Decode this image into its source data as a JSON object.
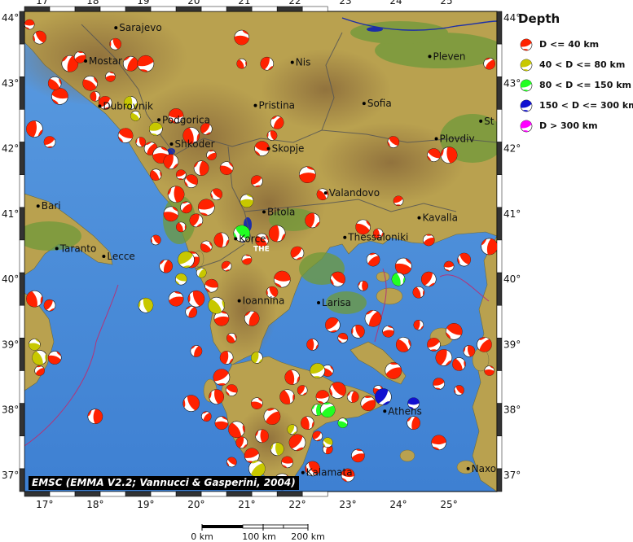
{
  "lon_ticks": [
    "17°",
    "18°",
    "19°",
    "20°",
    "21°",
    "22°",
    "23°",
    "24°",
    "25°"
  ],
  "lat_ticks": [
    "44°",
    "43°",
    "42°",
    "41°",
    "40°",
    "39°",
    "38°",
    "37°"
  ],
  "cities": [
    {
      "name": "Sarajevo",
      "lon": 18.41,
      "lat": 43.85
    },
    {
      "name": "Mostar",
      "lon": 17.81,
      "lat": 43.34
    },
    {
      "name": "Nis",
      "lon": 21.9,
      "lat": 43.32
    },
    {
      "name": "Pleven",
      "lon": 24.62,
      "lat": 43.41
    },
    {
      "name": "Pristina",
      "lon": 21.17,
      "lat": 42.66
    },
    {
      "name": "Sofia",
      "lon": 23.32,
      "lat": 42.69
    },
    {
      "name": "Dubrovnik",
      "lon": 18.09,
      "lat": 42.65
    },
    {
      "name": "Podgorica",
      "lon": 19.26,
      "lat": 42.44
    },
    {
      "name": "St",
      "lon": 25.63,
      "lat": 42.42
    },
    {
      "name": "Shkoder",
      "lon": 19.51,
      "lat": 42.07
    },
    {
      "name": "Skopje",
      "lon": 21.43,
      "lat": 42.0
    },
    {
      "name": "Plovdiv",
      "lon": 24.75,
      "lat": 42.15
    },
    {
      "name": "Bari",
      "lon": 16.87,
      "lat": 41.12
    },
    {
      "name": "Valandovo",
      "lon": 22.56,
      "lat": 41.32
    },
    {
      "name": "Bitola",
      "lon": 21.34,
      "lat": 41.03
    },
    {
      "name": "Kavalla",
      "lon": 24.41,
      "lat": 40.94
    },
    {
      "name": "Taranto",
      "lon": 17.24,
      "lat": 40.47
    },
    {
      "name": "Lecce",
      "lon": 18.17,
      "lat": 40.35
    },
    {
      "name": "Korce",
      "lon": 20.78,
      "lat": 40.62
    },
    {
      "name": "Thessaloniki",
      "lon": 22.94,
      "lat": 40.64
    },
    {
      "name": "Ioannina",
      "lon": 20.85,
      "lat": 39.67
    },
    {
      "name": "Larisa",
      "lon": 22.42,
      "lat": 39.64
    },
    {
      "name": "Athens",
      "lon": 23.73,
      "lat": 37.98
    },
    {
      "name": "Kalamata",
      "lon": 22.11,
      "lat": 37.04
    },
    {
      "name": "Naxo",
      "lon": 25.38,
      "lat": 37.1
    }
  ],
  "map_labels": [
    {
      "text": "THE",
      "lon": 21.13,
      "lat": 40.43
    }
  ],
  "legend": {
    "title": "Depth",
    "items": [
      {
        "label": "D <= 40 km",
        "color": "#ff2200"
      },
      {
        "label": "40 < D <= 80 km",
        "color": "#c8c800"
      },
      {
        "label": "80 < D <= 150 km",
        "color": "#22ff22"
      },
      {
        "label": "150 < D <= 300 km",
        "color": "#1010d0"
      },
      {
        "label": "D > 300 km",
        "color": "#ff00ff"
      }
    ]
  },
  "credit": "EMSC (EMMA V2.2; Vannucci & Gasperini, 2004)",
  "scale": {
    "labels": [
      "0 km",
      "100 km",
      "200 km"
    ]
  },
  "colors": {
    "sea": "#3f7fd0",
    "land_low": "#6f9a3a",
    "land_mid": "#bfa552",
    "land_high": "#7a5a2c",
    "border": "#555555",
    "lakes": "#1c2fa8"
  },
  "events": [
    {
      "lon": 16.7,
      "lat": 43.9,
      "c": 0
    },
    {
      "lon": 16.9,
      "lat": 43.7,
      "c": 0
    },
    {
      "lon": 17.5,
      "lat": 43.3,
      "c": 0
    },
    {
      "lon": 17.7,
      "lat": 43.4,
      "c": 0
    },
    {
      "lon": 17.9,
      "lat": 43.0,
      "c": 0
    },
    {
      "lon": 18.0,
      "lat": 42.8,
      "c": 0
    },
    {
      "lon": 18.2,
      "lat": 42.7,
      "c": 0
    },
    {
      "lon": 17.3,
      "lat": 42.8,
      "c": 0
    },
    {
      "lon": 18.4,
      "lat": 43.6,
      "c": 0
    },
    {
      "lon": 18.7,
      "lat": 43.3,
      "c": 0
    },
    {
      "lon": 18.3,
      "lat": 43.1,
      "c": 0
    },
    {
      "lon": 17.2,
      "lat": 43.0,
      "c": 0
    },
    {
      "lon": 16.8,
      "lat": 42.3,
      "c": 0
    },
    {
      "lon": 17.1,
      "lat": 42.1,
      "c": 0
    },
    {
      "lon": 18.6,
      "lat": 42.2,
      "c": 0
    },
    {
      "lon": 18.9,
      "lat": 42.1,
      "c": 0
    },
    {
      "lon": 19.1,
      "lat": 42.0,
      "c": 0
    },
    {
      "lon": 19.3,
      "lat": 41.9,
      "c": 0
    },
    {
      "lon": 19.2,
      "lat": 41.6,
      "c": 0
    },
    {
      "lon": 19.5,
      "lat": 41.8,
      "c": 0
    },
    {
      "lon": 19.7,
      "lat": 41.6,
      "c": 0
    },
    {
      "lon": 19.9,
      "lat": 41.5,
      "c": 0
    },
    {
      "lon": 19.6,
      "lat": 41.3,
      "c": 0
    },
    {
      "lon": 19.8,
      "lat": 41.1,
      "c": 0
    },
    {
      "lon": 19.5,
      "lat": 41.0,
      "c": 0
    },
    {
      "lon": 19.7,
      "lat": 40.8,
      "c": 0
    },
    {
      "lon": 20.0,
      "lat": 40.9,
      "c": 0
    },
    {
      "lon": 20.2,
      "lat": 41.1,
      "c": 0
    },
    {
      "lon": 20.4,
      "lat": 41.3,
      "c": 0
    },
    {
      "lon": 20.1,
      "lat": 41.7,
      "c": 0
    },
    {
      "lon": 20.3,
      "lat": 41.9,
      "c": 0
    },
    {
      "lon": 20.6,
      "lat": 41.7,
      "c": 0
    },
    {
      "lon": 19.9,
      "lat": 42.2,
      "c": 0
    },
    {
      "lon": 20.2,
      "lat": 42.3,
      "c": 0
    },
    {
      "lon": 19.6,
      "lat": 42.5,
      "c": 0
    },
    {
      "lon": 19.2,
      "lat": 40.6,
      "c": 0
    },
    {
      "lon": 19.4,
      "lat": 40.2,
      "c": 0
    },
    {
      "lon": 19.9,
      "lat": 40.3,
      "c": 0
    },
    {
      "lon": 20.2,
      "lat": 40.5,
      "c": 0
    },
    {
      "lon": 20.5,
      "lat": 40.6,
      "c": 0
    },
    {
      "lon": 20.6,
      "lat": 40.2,
      "c": 0
    },
    {
      "lon": 20.3,
      "lat": 39.9,
      "c": 0
    },
    {
      "lon": 20.0,
      "lat": 39.7,
      "c": 0
    },
    {
      "lon": 19.9,
      "lat": 39.5,
      "c": 0
    },
    {
      "lon": 20.5,
      "lat": 39.4,
      "c": 0
    },
    {
      "lon": 20.7,
      "lat": 39.1,
      "c": 0
    },
    {
      "lon": 20.6,
      "lat": 38.8,
      "c": 0
    },
    {
      "lon": 20.5,
      "lat": 38.5,
      "c": 0
    },
    {
      "lon": 20.7,
      "lat": 38.3,
      "c": 0
    },
    {
      "lon": 20.4,
      "lat": 38.2,
      "c": 0
    },
    {
      "lon": 20.2,
      "lat": 37.9,
      "c": 0
    },
    {
      "lon": 20.5,
      "lat": 37.8,
      "c": 0
    },
    {
      "lon": 20.8,
      "lat": 37.7,
      "c": 0
    },
    {
      "lon": 20.9,
      "lat": 37.5,
      "c": 0
    },
    {
      "lon": 21.1,
      "lat": 37.3,
      "c": 0
    },
    {
      "lon": 20.7,
      "lat": 37.2,
      "c": 0
    },
    {
      "lon": 21.3,
      "lat": 37.6,
      "c": 0
    },
    {
      "lon": 21.5,
      "lat": 37.9,
      "c": 0
    },
    {
      "lon": 21.2,
      "lat": 38.1,
      "c": 0
    },
    {
      "lon": 21.8,
      "lat": 38.2,
      "c": 0
    },
    {
      "lon": 22.1,
      "lat": 38.3,
      "c": 0
    },
    {
      "lon": 22.5,
      "lat": 38.2,
      "c": 0
    },
    {
      "lon": 22.8,
      "lat": 38.3,
      "c": 0
    },
    {
      "lon": 23.1,
      "lat": 38.2,
      "c": 0
    },
    {
      "lon": 23.4,
      "lat": 38.1,
      "c": 0
    },
    {
      "lon": 23.6,
      "lat": 38.3,
      "c": 0
    },
    {
      "lon": 22.2,
      "lat": 37.8,
      "c": 0
    },
    {
      "lon": 22.0,
      "lat": 37.5,
      "c": 0
    },
    {
      "lon": 21.8,
      "lat": 37.2,
      "c": 0
    },
    {
      "lon": 22.3,
      "lat": 37.1,
      "c": 0
    },
    {
      "lon": 22.6,
      "lat": 37.4,
      "c": 0
    },
    {
      "lon": 23.2,
      "lat": 37.3,
      "c": 0
    },
    {
      "lon": 21.7,
      "lat": 36.9,
      "c": 0
    },
    {
      "lon": 22.3,
      "lat": 39.0,
      "c": 0
    },
    {
      "lon": 22.7,
      "lat": 39.3,
      "c": 0
    },
    {
      "lon": 22.9,
      "lat": 39.1,
      "c": 0
    },
    {
      "lon": 23.2,
      "lat": 39.2,
      "c": 0
    },
    {
      "lon": 23.5,
      "lat": 39.4,
      "c": 0
    },
    {
      "lon": 23.8,
      "lat": 39.2,
      "c": 0
    },
    {
      "lon": 24.1,
      "lat": 39.0,
      "c": 0
    },
    {
      "lon": 24.4,
      "lat": 39.3,
      "c": 0
    },
    {
      "lon": 24.7,
      "lat": 39.0,
      "c": 0
    },
    {
      "lon": 25.1,
      "lat": 39.2,
      "c": 0
    },
    {
      "lon": 25.4,
      "lat": 38.9,
      "c": 0
    },
    {
      "lon": 25.7,
      "lat": 39.0,
      "c": 0
    },
    {
      "lon": 25.8,
      "lat": 38.6,
      "c": 0
    },
    {
      "lon": 25.2,
      "lat": 38.7,
      "c": 0
    },
    {
      "lon": 24.9,
      "lat": 38.8,
      "c": 0
    },
    {
      "lon": 24.8,
      "lat": 38.4,
      "c": 0
    },
    {
      "lon": 22.8,
      "lat": 40.0,
      "c": 0
    },
    {
      "lon": 23.3,
      "lat": 39.9,
      "c": 0
    },
    {
      "lon": 23.5,
      "lat": 40.3,
      "c": 0
    },
    {
      "lon": 24.1,
      "lat": 40.2,
      "c": 0
    },
    {
      "lon": 24.4,
      "lat": 39.8,
      "c": 0
    },
    {
      "lon": 24.6,
      "lat": 40.0,
      "c": 0
    },
    {
      "lon": 25.0,
      "lat": 40.2,
      "c": 0
    },
    {
      "lon": 25.3,
      "lat": 40.3,
      "c": 0
    },
    {
      "lon": 25.8,
      "lat": 40.5,
      "c": 0
    },
    {
      "lon": 24.6,
      "lat": 40.6,
      "c": 0
    },
    {
      "lon": 23.3,
      "lat": 40.8,
      "c": 0
    },
    {
      "lon": 23.6,
      "lat": 40.7,
      "c": 0
    },
    {
      "lon": 22.0,
      "lat": 40.4,
      "c": 0
    },
    {
      "lon": 21.7,
      "lat": 40.0,
      "c": 0
    },
    {
      "lon": 21.5,
      "lat": 39.8,
      "c": 0
    },
    {
      "lon": 21.1,
      "lat": 39.4,
      "c": 0
    },
    {
      "lon": 21.0,
      "lat": 40.3,
      "c": 0
    },
    {
      "lon": 21.3,
      "lat": 40.6,
      "c": 0
    },
    {
      "lon": 21.6,
      "lat": 40.7,
      "c": 0
    },
    {
      "lon": 21.2,
      "lat": 41.5,
      "c": 0
    },
    {
      "lon": 21.3,
      "lat": 42.0,
      "c": 0
    },
    {
      "lon": 21.5,
      "lat": 42.2,
      "c": 0
    },
    {
      "lon": 21.6,
      "lat": 42.4,
      "c": 0
    },
    {
      "lon": 22.2,
      "lat": 41.6,
      "c": 0
    },
    {
      "lon": 22.5,
      "lat": 41.3,
      "c": 0
    },
    {
      "lon": 22.3,
      "lat": 40.9,
      "c": 0
    },
    {
      "lon": 24.0,
      "lat": 41.2,
      "c": 0
    },
    {
      "lon": 24.7,
      "lat": 41.9,
      "c": 0
    },
    {
      "lon": 25.0,
      "lat": 41.9,
      "c": 0
    },
    {
      "lon": 25.8,
      "lat": 43.3,
      "c": 0
    },
    {
      "lon": 20.9,
      "lat": 43.7,
      "c": 0
    },
    {
      "lon": 20.9,
      "lat": 43.3,
      "c": 0
    },
    {
      "lon": 21.4,
      "lat": 43.3,
      "c": 0
    },
    {
      "lon": 19.0,
      "lat": 43.3,
      "c": 0
    },
    {
      "lon": 23.9,
      "lat": 42.1,
      "c": 0
    },
    {
      "lon": 18.0,
      "lat": 37.9,
      "c": 0
    },
    {
      "lon": 16.9,
      "lat": 38.6,
      "c": 0
    },
    {
      "lon": 17.2,
      "lat": 38.8,
      "c": 0
    },
    {
      "lon": 16.8,
      "lat": 39.7,
      "c": 0
    },
    {
      "lon": 17.1,
      "lat": 39.6,
      "c": 0
    },
    {
      "lon": 24.8,
      "lat": 37.5,
      "c": 0
    },
    {
      "lon": 25.2,
      "lat": 38.3,
      "c": 0
    },
    {
      "lon": 24.3,
      "lat": 37.8,
      "c": 0
    },
    {
      "lon": 23.9,
      "lat": 38.6,
      "c": 0
    },
    {
      "lon": 22.6,
      "lat": 38.6,
      "c": 0
    },
    {
      "lon": 21.9,
      "lat": 38.5,
      "c": 0
    },
    {
      "lon": 22.4,
      "lat": 37.6,
      "c": 0
    },
    {
      "lon": 23.0,
      "lat": 37.0,
      "c": 0
    },
    {
      "lon": 19.9,
      "lat": 38.1,
      "c": 0
    },
    {
      "lon": 20.0,
      "lat": 38.9,
      "c": 0
    },
    {
      "lon": 19.6,
      "lat": 39.7,
      "c": 0
    },
    {
      "lon": 18.8,
      "lat": 42.5,
      "c": 1
    },
    {
      "lon": 18.7,
      "lat": 42.7,
      "c": 1
    },
    {
      "lon": 19.8,
      "lat": 40.3,
      "c": 1
    },
    {
      "lon": 19.7,
      "lat": 40.0,
      "c": 1
    },
    {
      "lon": 19.0,
      "lat": 39.6,
      "c": 1
    },
    {
      "lon": 20.1,
      "lat": 40.1,
      "c": 1
    },
    {
      "lon": 21.0,
      "lat": 41.2,
      "c": 1
    },
    {
      "lon": 20.4,
      "lat": 39.6,
      "c": 1
    },
    {
      "lon": 21.2,
      "lat": 38.8,
      "c": 1
    },
    {
      "lon": 22.4,
      "lat": 38.6,
      "c": 1
    },
    {
      "lon": 22.6,
      "lat": 37.5,
      "c": 1
    },
    {
      "lon": 21.6,
      "lat": 37.4,
      "c": 1
    },
    {
      "lon": 21.2,
      "lat": 37.1,
      "c": 1
    },
    {
      "lon": 16.8,
      "lat": 39.0,
      "c": 1
    },
    {
      "lon": 16.9,
      "lat": 38.8,
      "c": 1
    },
    {
      "lon": 21.9,
      "lat": 37.7,
      "c": 1
    },
    {
      "lon": 19.2,
      "lat": 42.3,
      "c": 1
    },
    {
      "lon": 20.9,
      "lat": 40.7,
      "c": 2
    },
    {
      "lon": 22.4,
      "lat": 38.0,
      "c": 2
    },
    {
      "lon": 22.6,
      "lat": 38.0,
      "c": 2
    },
    {
      "lon": 22.9,
      "lat": 37.8,
      "c": 2
    },
    {
      "lon": 24.0,
      "lat": 40.0,
      "c": 2
    },
    {
      "lon": 23.7,
      "lat": 38.2,
      "c": 3
    },
    {
      "lon": 24.3,
      "lat": 38.1,
      "c": 3
    }
  ]
}
